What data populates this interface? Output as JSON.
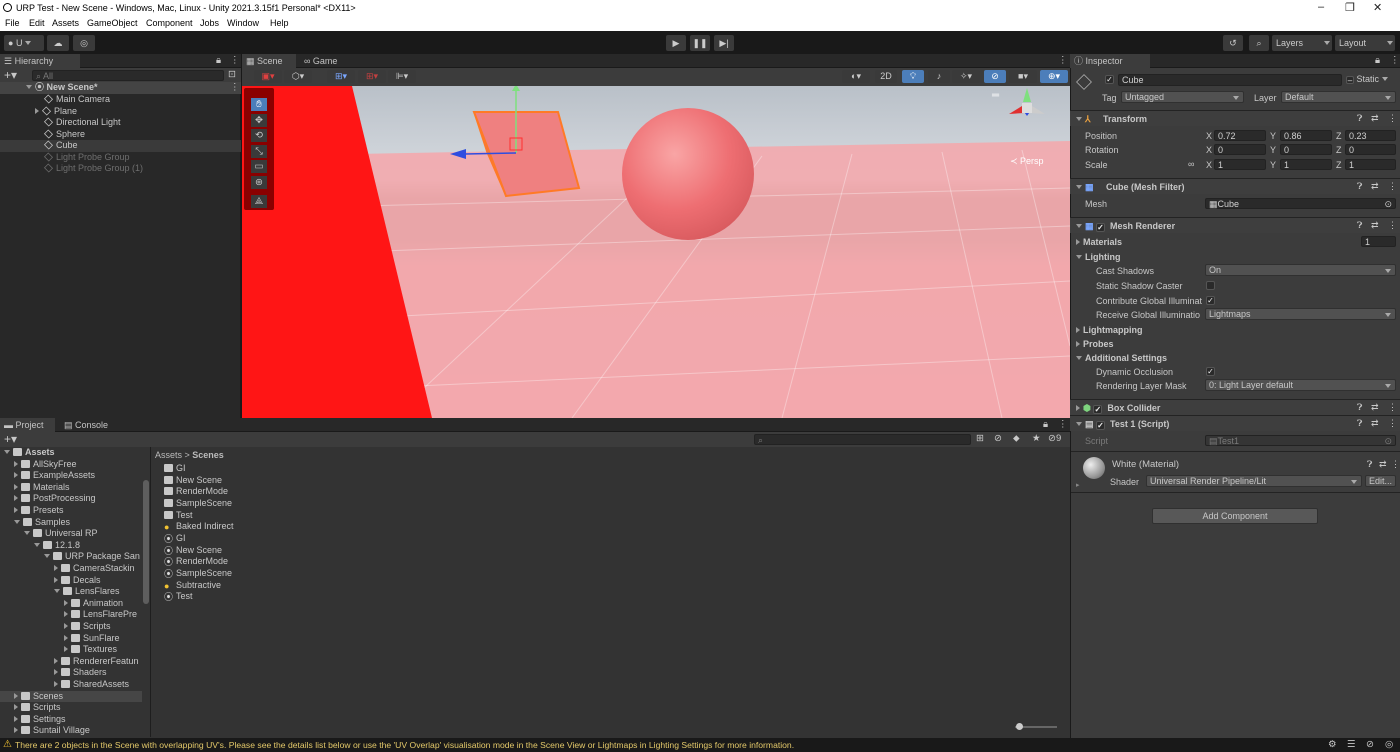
{
  "window": {
    "title": "URP Test - New Scene - Windows, Mac, Linux - Unity 2021.3.15f1 Personal* <DX11>"
  },
  "menu": [
    "File",
    "Edit",
    "Assets",
    "GameObject",
    "Component",
    "Jobs",
    "Window",
    "Help"
  ],
  "toolbar": {
    "account": "U",
    "layers": "Layers",
    "layout": "Layout"
  },
  "hierarchy": {
    "tab": "Hierarchy",
    "search_placeholder": "All",
    "scene": "New Scene*",
    "items": [
      "Main Camera",
      "Plane",
      "Directional Light",
      "Sphere",
      "Cube",
      "Light Probe Group",
      "Light Probe Group (1)"
    ]
  },
  "scene": {
    "tabs": [
      "Scene",
      "Game"
    ],
    "mode_2d": "2D",
    "persp": "Persp"
  },
  "inspector": {
    "tab": "Inspector",
    "object_name": "Cube",
    "static_label": "Static",
    "tag_label": "Tag",
    "tag_value": "Untagged",
    "layer_label": "Layer",
    "layer_value": "Default",
    "transform": {
      "title": "Transform",
      "position_label": "Position",
      "rotation_label": "Rotation",
      "scale_label": "Scale",
      "position": {
        "x": "0.72",
        "y": "0.86",
        "z": "0.23"
      },
      "rotation": {
        "x": "0",
        "y": "0",
        "z": "0"
      },
      "scale": {
        "x": "1",
        "y": "1",
        "z": "1"
      }
    },
    "mesh_filter": {
      "title": "Cube (Mesh Filter)",
      "mesh_label": "Mesh",
      "mesh_value": "Cube"
    },
    "mesh_renderer": {
      "title": "Mesh Renderer",
      "materials_label": "Materials",
      "materials_count": "1",
      "lighting_label": "Lighting",
      "cast_shadows_label": "Cast Shadows",
      "cast_shadows_value": "On",
      "static_shadow_label": "Static Shadow Caster",
      "contribute_gi_label": "Contribute Global Illuminat",
      "receive_gi_label": "Receive Global Illuminatio",
      "receive_gi_value": "Lightmaps",
      "lightmapping_label": "Lightmapping",
      "probes_label": "Probes",
      "additional_label": "Additional Settings",
      "dynamic_occlusion_label": "Dynamic Occlusion",
      "rendering_layer_label": "Rendering Layer Mask",
      "rendering_layer_value": "0: Light Layer default"
    },
    "box_collider": {
      "title": "Box Collider"
    },
    "script": {
      "title": "Test 1 (Script)",
      "script_label": "Script",
      "script_value": "Test1"
    },
    "material": {
      "title": "White (Material)",
      "shader_label": "Shader",
      "shader_value": "Universal Render Pipeline/Lit",
      "edit_label": "Edit..."
    },
    "add_component": "Add Component"
  },
  "project": {
    "tabs": [
      "Project",
      "Console"
    ],
    "breadcrumb": [
      "Assets",
      "Scenes"
    ],
    "hidden_count": "9",
    "tree": [
      {
        "label": "Assets",
        "indent": 0,
        "open": true,
        "bold": true
      },
      {
        "label": "AllSkyFree",
        "indent": 1
      },
      {
        "label": "ExampleAssets",
        "indent": 1
      },
      {
        "label": "Materials",
        "indent": 1
      },
      {
        "label": "PostProcessing",
        "indent": 1
      },
      {
        "label": "Presets",
        "indent": 1
      },
      {
        "label": "Samples",
        "indent": 1,
        "open": true
      },
      {
        "label": "Universal RP",
        "indent": 2,
        "open": true
      },
      {
        "label": "12.1.8",
        "indent": 3,
        "open": true
      },
      {
        "label": "URP Package San",
        "indent": 4,
        "open": true
      },
      {
        "label": "CameraStackin",
        "indent": 5
      },
      {
        "label": "Decals",
        "indent": 5
      },
      {
        "label": "LensFlares",
        "indent": 5,
        "open": true
      },
      {
        "label": "Animation",
        "indent": 6
      },
      {
        "label": "LensFlarePre",
        "indent": 6
      },
      {
        "label": "Scripts",
        "indent": 6
      },
      {
        "label": "SunFlare",
        "indent": 6
      },
      {
        "label": "Textures",
        "indent": 6
      },
      {
        "label": "RendererFeatun",
        "indent": 5
      },
      {
        "label": "Shaders",
        "indent": 5
      },
      {
        "label": "SharedAssets",
        "indent": 5
      },
      {
        "label": "Scenes",
        "indent": 1,
        "selected": true
      },
      {
        "label": "Scripts",
        "indent": 1
      },
      {
        "label": "Settings",
        "indent": 1
      },
      {
        "label": "Suntail Village",
        "indent": 1
      }
    ],
    "files": [
      {
        "label": "GI",
        "kind": "folder"
      },
      {
        "label": "New Scene",
        "kind": "folder"
      },
      {
        "label": "RenderMode",
        "kind": "folder"
      },
      {
        "label": "SampleScene",
        "kind": "folder"
      },
      {
        "label": "Test",
        "kind": "folder"
      },
      {
        "label": "Baked Indirect",
        "kind": "lighting"
      },
      {
        "label": "GI",
        "kind": "scene"
      },
      {
        "label": "New Scene",
        "kind": "scene"
      },
      {
        "label": "RenderMode",
        "kind": "scene"
      },
      {
        "label": "SampleScene",
        "kind": "scene"
      },
      {
        "label": "Subtractive",
        "kind": "lighting"
      },
      {
        "label": "Test",
        "kind": "scene"
      }
    ]
  },
  "status": {
    "message": "There are 2 objects in the Scene with overlapping UV's. Please see the details list below or use the 'UV Overlap' visualisation mode in the Scene View or Lightmaps in Lighting Settings for more information."
  }
}
